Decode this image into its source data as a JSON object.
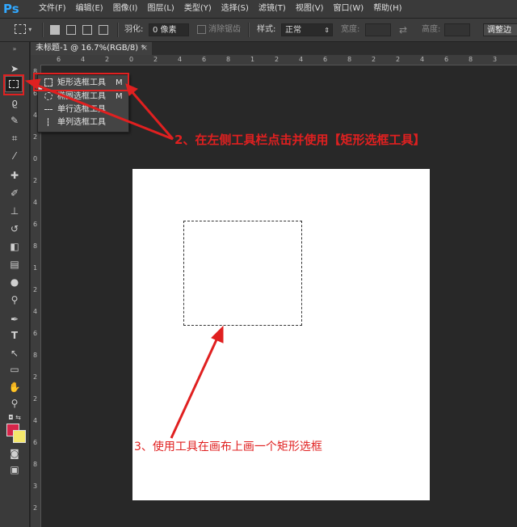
{
  "app": {
    "logo": "Ps"
  },
  "menu": [
    "文件(F)",
    "编辑(E)",
    "图像(I)",
    "图层(L)",
    "类型(Y)",
    "选择(S)",
    "滤镜(T)",
    "视图(V)",
    "窗口(W)",
    "帮助(H)"
  ],
  "options": {
    "feather_label": "羽化:",
    "feather_value": "0 像素",
    "antialias_label": "消除锯齿",
    "style_label": "样式:",
    "style_value": "正常",
    "width_label": "宽度:",
    "height_label": "高度:",
    "refine_button": "调整边"
  },
  "tab": {
    "title": "未标题-1 @ 16.7%(RGB/8) *",
    "close": "×"
  },
  "flyout": [
    {
      "icon": "rect-marquee-icon",
      "label": "矩形选框工具",
      "key": "M"
    },
    {
      "icon": "ellipse-marquee-icon",
      "label": "椭圆选框工具",
      "key": "M"
    },
    {
      "icon": "single-row-marquee-icon",
      "label": "单行选框工具",
      "key": ""
    },
    {
      "icon": "single-column-marquee-icon",
      "label": "单列选框工具",
      "key": ""
    }
  ],
  "ruler_top": [
    "6",
    "4",
    "2",
    "0",
    "2",
    "4",
    "6",
    "8",
    "1",
    "2",
    "4",
    "6",
    "8",
    "2",
    "2",
    "4",
    "6",
    "8",
    "3"
  ],
  "ruler_left": [
    "8",
    "6",
    "4",
    "2",
    "0",
    "2",
    "4",
    "6",
    "8",
    "1",
    "2",
    "4",
    "6",
    "8",
    "2",
    "2",
    "4",
    "6",
    "8",
    "3",
    "2"
  ],
  "annotations": {
    "step2": "2、在左侧工具栏点击并使用【矩形选框工具】",
    "step3": "3、使用工具在画布上画一个矩形选框"
  },
  "colors": {
    "annotation": "#e02020",
    "foreground": "#d7254a",
    "background": "#f4e76b",
    "accent": "#31a8ff"
  }
}
